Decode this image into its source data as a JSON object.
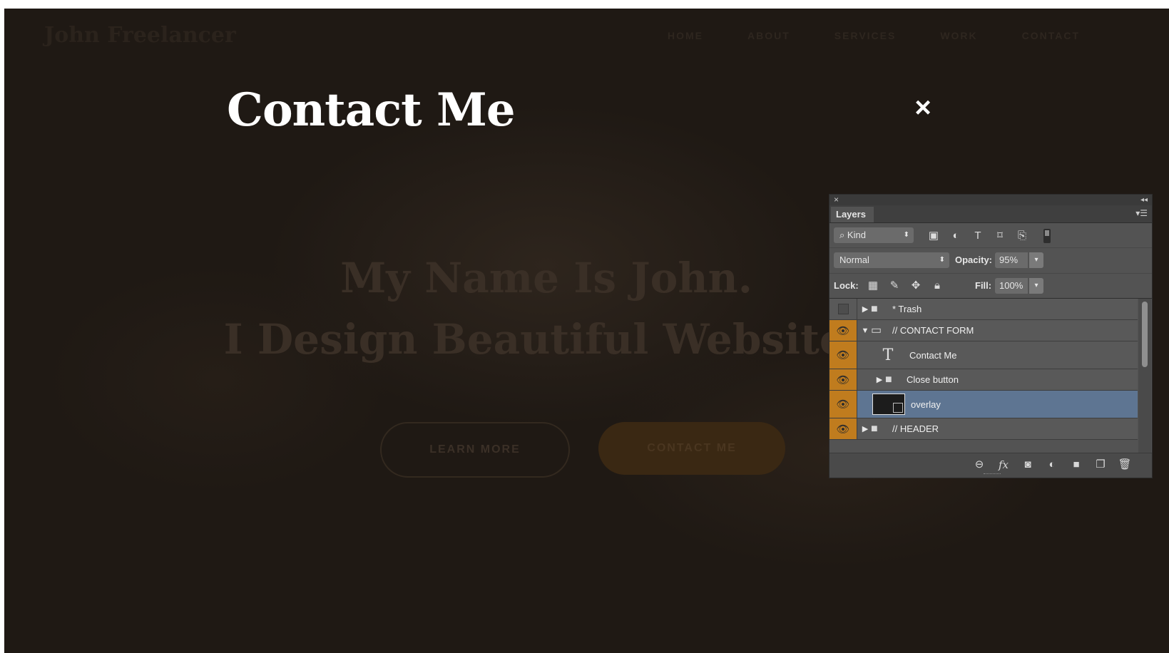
{
  "site": {
    "logo": "John Freelancer",
    "nav": [
      "HOME",
      "ABOUT",
      "SERVICES",
      "WORK",
      "CONTACT"
    ],
    "hero_line1": "My Name Is John.",
    "hero_line2": "I Design Beautiful Websites",
    "btn_learn": "LEARN MORE",
    "btn_contact": "CONTACT ME"
  },
  "overlay": {
    "title": "Contact Me",
    "close": "×"
  },
  "panel": {
    "close": "×",
    "collapse": "◂◂",
    "tab": "Layers",
    "kind": "Kind",
    "blend_mode": "Normal",
    "opacity_label": "Opacity:",
    "opacity_value": "95%",
    "lock_label": "Lock:",
    "fill_label": "Fill:",
    "fill_value": "100%",
    "layers": [
      {
        "name": "* Trash",
        "visible": false
      },
      {
        "name": "// CONTACT FORM",
        "visible": true
      },
      {
        "name": "Contact Me",
        "visible": true
      },
      {
        "name": "Close button",
        "visible": true
      },
      {
        "name": "overlay",
        "visible": true,
        "selected": true
      },
      {
        "name": "// HEADER",
        "visible": true
      }
    ]
  },
  "colors": {
    "overlay_bg": "#1f1914",
    "visibility_column": "#c07c1e",
    "selected_layer": "#5e7592"
  }
}
